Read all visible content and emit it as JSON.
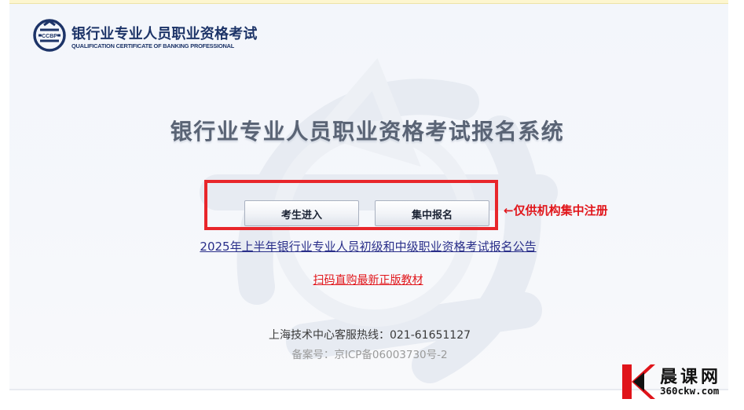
{
  "brand": {
    "title_cn": "银行业专业人员职业资格考试",
    "title_en": "QUALIFICATION CERTIFICATE OF BANKING PROFESSIONAL",
    "logo_text": "CCBP"
  },
  "main": {
    "system_title": "银行业专业人员职业资格考试报名系统",
    "buttons": {
      "enter_label": "考生进入",
      "batch_label": "集中报名"
    },
    "annotation": "←仅供机构集中注册",
    "links": {
      "notice": "2025年上半年银行业专业人员初级和中级职业资格考试报名公告",
      "textbook": "扫码直购最新正版教材"
    }
  },
  "footer": {
    "hotline": "上海技术中心客服热线：021-61651127",
    "icp": "备案号：京ICP备06003730号-2"
  },
  "corner_watermark": {
    "name": "晨课网",
    "url": "360ckw.com"
  },
  "colors": {
    "brand_navy": "#1d3468",
    "highlight_red": "#e8262b",
    "link_blue": "#2a2f8a",
    "link_red": "#e1161b"
  }
}
